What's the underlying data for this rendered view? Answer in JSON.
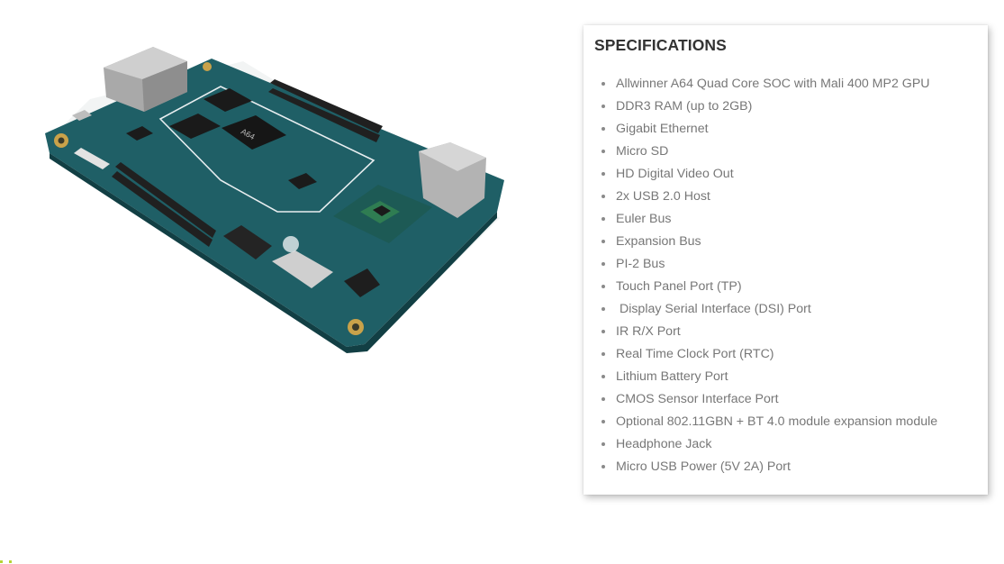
{
  "product_image": {
    "alt": "Single board computer with Allwinner A64 chip",
    "chip_label": "A64",
    "colors": {
      "pcb": "#1f5f66",
      "pcb_dark": "#184e55",
      "silkscreen": "#e8eef0",
      "metal": "#b9b9b9",
      "gold": "#c9a24a"
    }
  },
  "specifications": {
    "title": "SPECIFICATIONS",
    "items": [
      "Allwinner A64 Quad Core SOC with Mali 400 MP2 GPU",
      "DDR3 RAM (up to 2GB)",
      "Gigabit Ethernet",
      "Micro SD",
      "HD Digital Video Out",
      "2x USB 2.0 Host",
      "Euler Bus",
      "Expansion Bus",
      "PI-2 Bus",
      "Touch Panel Port (TP)",
      " Display Serial Interface (DSI) Port",
      "IR R/X Port",
      "Real Time Clock Port (RTC)",
      "Lithium Battery Port",
      "CMOS Sensor Interface Port",
      "Optional 802.11GBN + BT 4.0 module expansion module",
      "Headphone Jack",
      "Micro USB Power (5V 2A) Port"
    ]
  }
}
